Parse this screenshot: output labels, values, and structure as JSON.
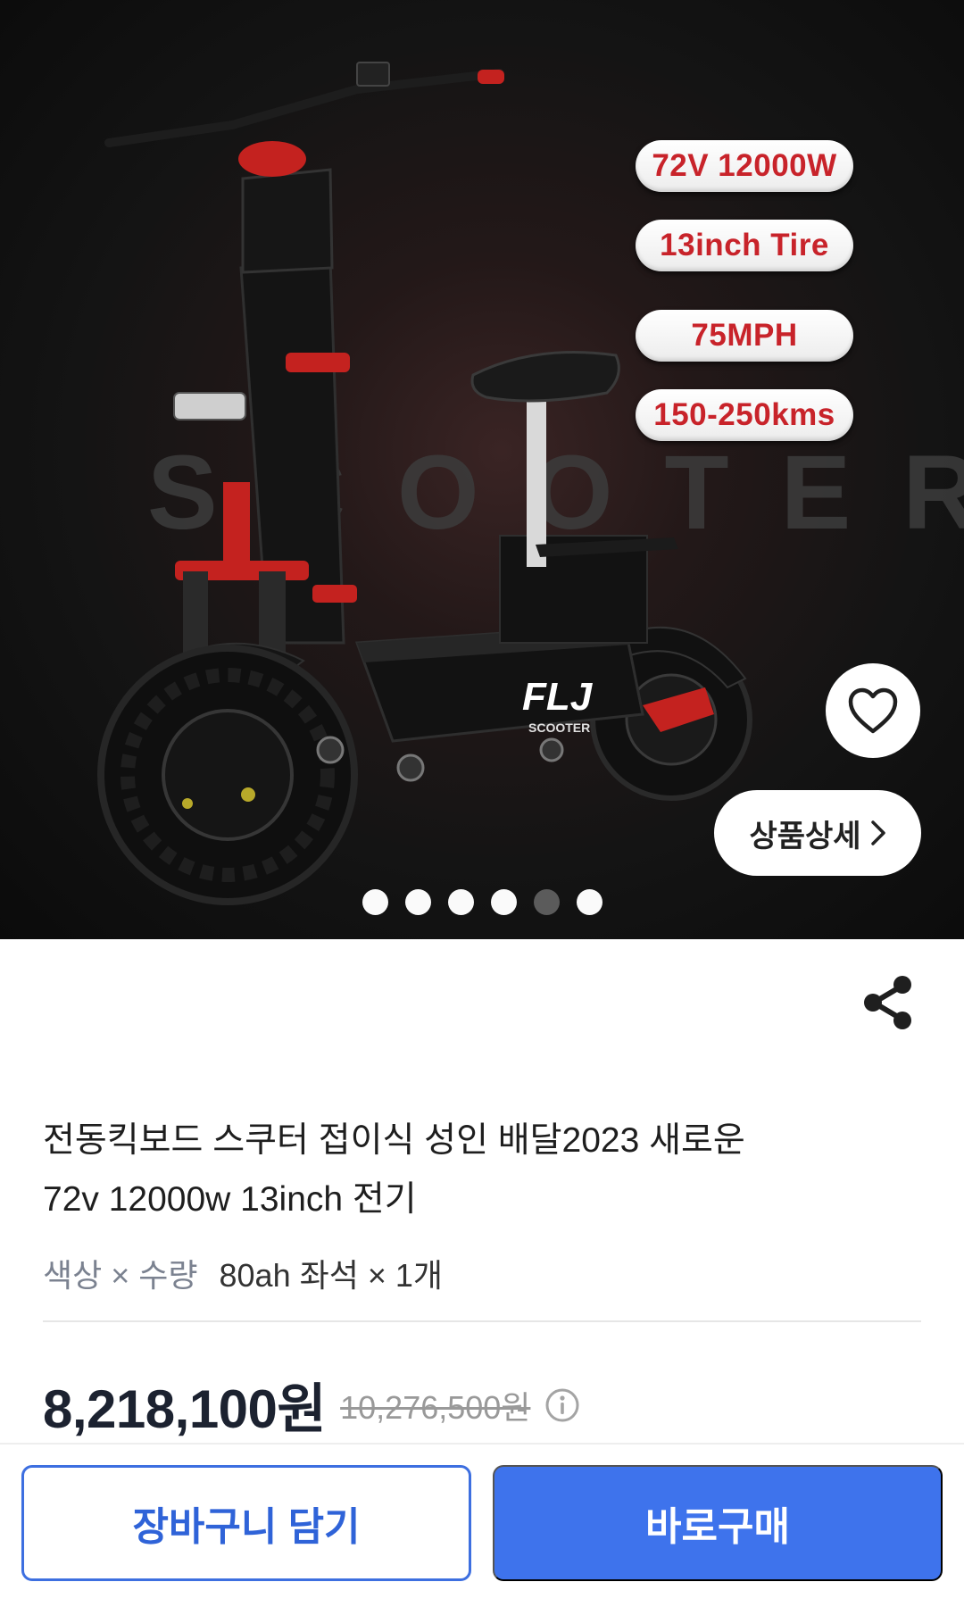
{
  "hero": {
    "watermark_text": "SCOOTER",
    "brand_logo": "FLJ",
    "brand_sub": "SCOOTER",
    "specs": [
      "72V 12000W",
      "13inch Tire",
      "75MPH",
      "150-250kms"
    ],
    "detail_label": "상품상세",
    "total_slides": 6,
    "active_slide_index": 4
  },
  "product": {
    "title_line1": "전동킥보드 스쿠터 접이식 성인 배달2023 새로운",
    "title_line2": "72v 12000w 13inch 전기",
    "option_label": "색상 × 수량",
    "option_value": "80ah 좌석 × 1개",
    "price": "8,218,100원",
    "original_price": "10,276,500원"
  },
  "actions": {
    "cart_label": "장바구니 담기",
    "buy_label": "바로구매"
  },
  "colors": {
    "accent_blue": "#3e73ec",
    "spec_red": "#c8232a"
  }
}
